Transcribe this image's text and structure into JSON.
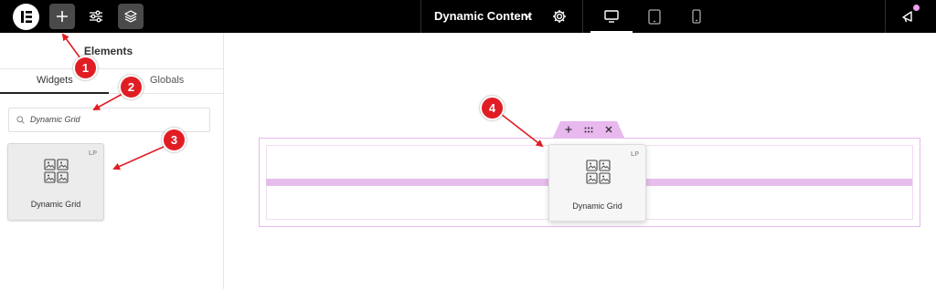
{
  "topbar": {
    "document_title": "Dynamic Content",
    "logo_icon": "elementor-logo-icon",
    "buttons": [
      "add-element-icon",
      "site-settings-icon",
      "structure-layers-icon"
    ],
    "devices": [
      "desktop-icon",
      "tablet-icon",
      "mobile-icon"
    ],
    "active_device": "desktop",
    "notification_dot_color": "#f0a0ea"
  },
  "panel": {
    "title": "Elements",
    "tabs": [
      {
        "label": "Widgets",
        "active": true
      },
      {
        "label": "Globals",
        "active": false
      }
    ],
    "search": {
      "value": "Dynamic Grid",
      "icon": "search-icon"
    },
    "widgets": [
      {
        "label": "Dynamic Grid",
        "badge": "LP",
        "icon": "dynamic-grid-icon"
      }
    ]
  },
  "canvas": {
    "section_handle_icons": [
      "add-icon",
      "drag-handle-icon",
      "close-icon"
    ],
    "dragged_widget": {
      "label": "Dynamic Grid",
      "badge": "LP",
      "icon": "dynamic-grid-icon"
    },
    "accent_color": "#e8b8ee"
  },
  "annotations": [
    {
      "number": "1"
    },
    {
      "number": "2"
    },
    {
      "number": "3"
    },
    {
      "number": "4"
    }
  ],
  "annotation_color": "#e11d24"
}
